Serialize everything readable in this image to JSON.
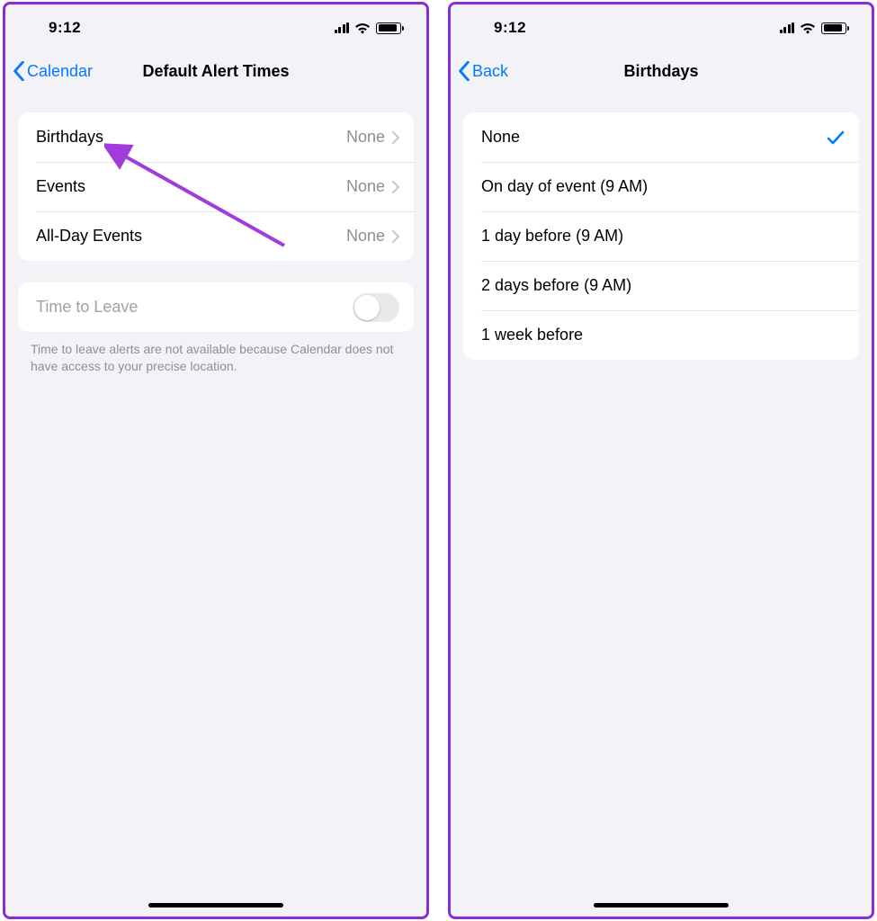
{
  "status": {
    "time": "9:12"
  },
  "left": {
    "back_label": "Calendar",
    "title": "Default Alert Times",
    "items": [
      {
        "label": "Birthdays",
        "value": "None"
      },
      {
        "label": "Events",
        "value": "None"
      },
      {
        "label": "All-Day Events",
        "value": "None"
      }
    ],
    "time_to_leave_label": "Time to Leave",
    "footer": "Time to leave alerts are not available because Calendar does not have access to your precise location."
  },
  "right": {
    "back_label": "Back",
    "title": "Birthdays",
    "options": [
      {
        "label": "None",
        "selected": true
      },
      {
        "label": "On day of event (9 AM)",
        "selected": false
      },
      {
        "label": "1 day before (9 AM)",
        "selected": false
      },
      {
        "label": "2 days before (9 AM)",
        "selected": false
      },
      {
        "label": "1 week before",
        "selected": false
      }
    ]
  }
}
